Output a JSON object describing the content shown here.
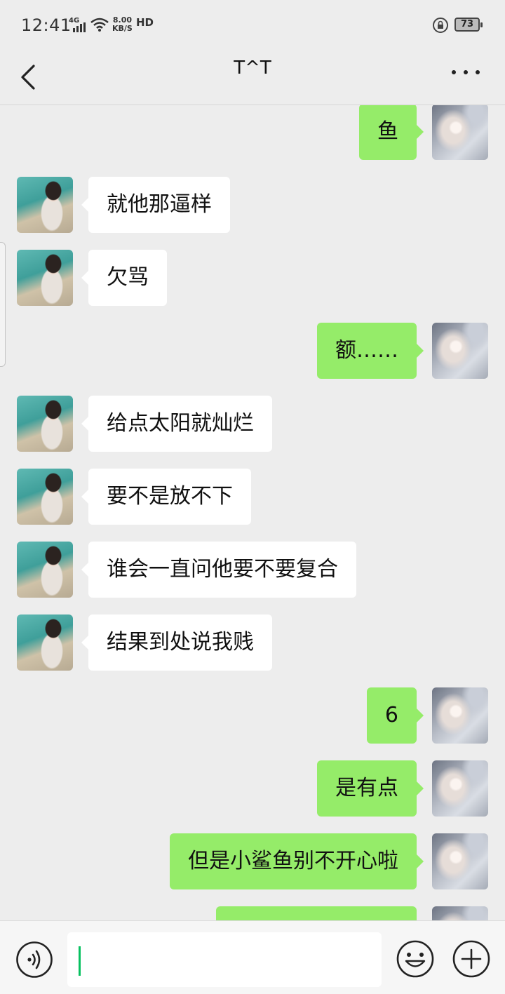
{
  "status_bar": {
    "time": "12:41",
    "network": "4G",
    "speed_value": "8.00",
    "speed_unit": "KB/S",
    "hd": "HD",
    "battery": "73",
    "icons": [
      "signal-bars-icon",
      "wifi-icon",
      "rotation-lock-icon",
      "battery-icon"
    ]
  },
  "header": {
    "title": "T^T",
    "back_icon": "chevron-left-icon",
    "more_icon": "more-dots-icon"
  },
  "messages": [
    {
      "side": "right",
      "text": "鱼"
    },
    {
      "side": "left",
      "text": "就他那逼样"
    },
    {
      "side": "left",
      "text": "欠骂"
    },
    {
      "side": "right",
      "text": "额……"
    },
    {
      "side": "left",
      "text": "给点太阳就灿烂"
    },
    {
      "side": "left",
      "text": "要不是放不下"
    },
    {
      "side": "left",
      "text": "谁会一直问他要不要复合"
    },
    {
      "side": "left",
      "text": "结果到处说我贱"
    },
    {
      "side": "right",
      "text": "6"
    },
    {
      "side": "right",
      "text": "是有点"
    },
    {
      "side": "right",
      "text": "但是小鲨鱼别不开心啦"
    },
    {
      "side": "right",
      "text": ""
    }
  ],
  "input_bar": {
    "value": "",
    "voice_icon": "voice-icon",
    "emoji_icon": "emoji-icon",
    "plus_icon": "plus-icon"
  },
  "colors": {
    "background": "#ededed",
    "sent_bubble": "#95ec69",
    "received_bubble": "#ffffff",
    "caret": "#07c160"
  }
}
